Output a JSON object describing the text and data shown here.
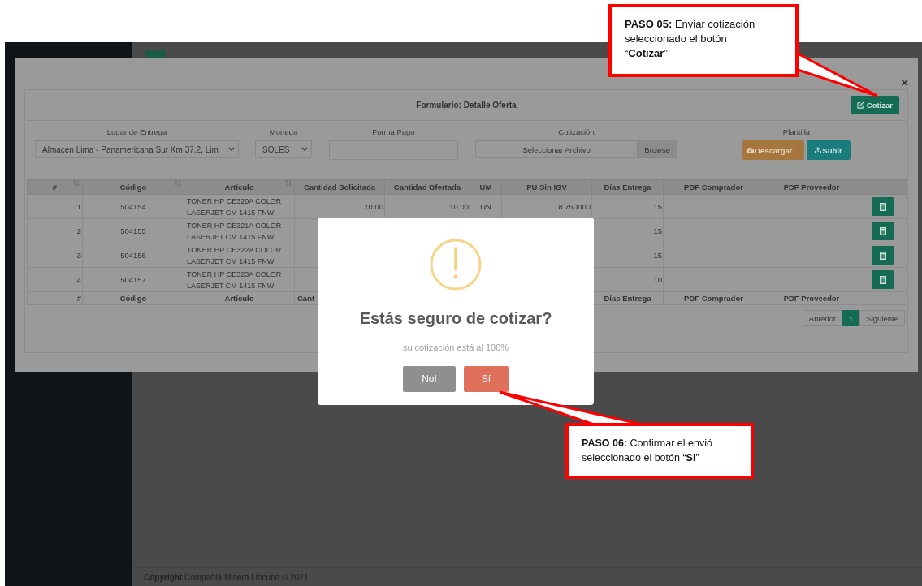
{
  "topbar": {
    "menu_button": true
  },
  "footer": {
    "text": "**Copyright** Compañía Minera Lincuna © 2021"
  },
  "modal": {
    "close": "×",
    "title": "Formulario: Detalle Oferta",
    "cotizar_button": "Cotizar",
    "form": {
      "lugar_label": "Lugar de Entrega",
      "lugar_value": "Almacen Lima - Panamericana Sur Km 37.2, Lim",
      "moneda_label": "Moneda",
      "moneda_value": "SOLES",
      "forma_pago_label": "Forma Pago",
      "cotizacion_label": "Cotización",
      "file_placeholder": "Seleccionar Archivo",
      "browse": "Browse",
      "plantilla_label": "Plantilla",
      "descargar": "Descargar",
      "subir": "Subir"
    },
    "table": {
      "columns": [
        {
          "label": "#",
          "sortable": true
        },
        {
          "label": "Código",
          "sortable": true
        },
        {
          "label": "Artículo",
          "sortable": true
        },
        {
          "label": "Cantidad Solicitada",
          "sortable": false
        },
        {
          "label": "Cantidad Ofertada",
          "sortable": false
        },
        {
          "label": "UM",
          "sortable": false
        },
        {
          "label": "PU Sin IGV",
          "sortable": false
        },
        {
          "label": "Días Entrega",
          "sortable": false
        },
        {
          "label": "PDF Comprador",
          "sortable": false
        },
        {
          "label": "PDF Proveedor",
          "sortable": false
        }
      ],
      "rows": [
        [
          "1",
          "504154",
          "TONER HP CE320A COLOR LASERJET CM 1415 FNW",
          "10.00",
          "10.00",
          "UN",
          "8.750000",
          "15"
        ],
        [
          "2",
          "504155",
          "TONER HP CE321A COLOR LASERJET CM 1415 FNW",
          null,
          null,
          null,
          null,
          "15"
        ],
        [
          "3",
          "504156",
          "TONER HP CE322A COLOR LASERJET CM 1415 FNW",
          null,
          null,
          null,
          null,
          "15"
        ],
        [
          "4",
          "504157",
          "TONER HP CE323A COLOR LASERJET CM 1415 FNW",
          null,
          null,
          null,
          null,
          "10"
        ]
      ],
      "footer_columns": [
        "#",
        "Código",
        "Artículo",
        "Cant",
        null,
        null,
        null,
        "Días Entrega",
        "PDF Comprador",
        "PDF Proveedor"
      ]
    },
    "pagination": [
      {
        "label": "Anterior",
        "selected": false
      },
      {
        "label": "1",
        "selected": true
      },
      {
        "label": "Siguiente",
        "selected": false
      }
    ]
  },
  "dialog": {
    "title": "Estás seguro de cotizar?",
    "message": "su cotización está al 100%",
    "buttons": [
      {
        "label": "No!",
        "kind": "cancel"
      },
      {
        "label": "Sí",
        "kind": "confirm"
      }
    ]
  },
  "callouts": [
    {
      "text": "**PASO 05:** Enviar cotización seleccionado el botón “**Cotizar**”"
    },
    {
      "text": "**PASO 06:** Confirmar el envió seleccionado el botón “**Si**”"
    }
  ]
}
